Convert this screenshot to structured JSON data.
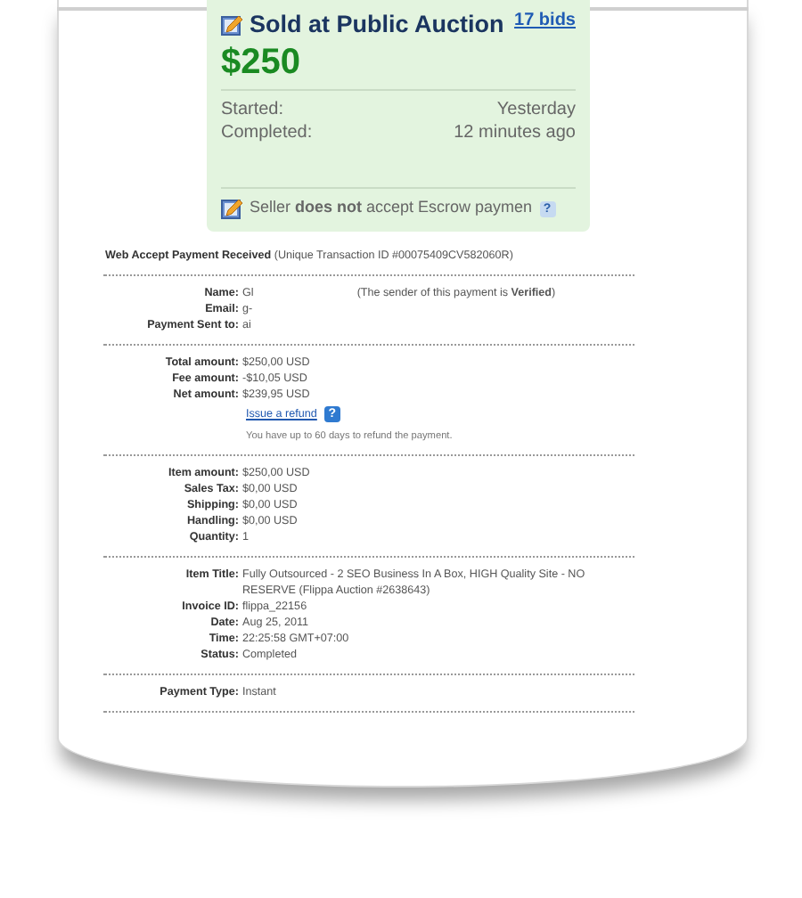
{
  "auction": {
    "title": "Sold at Public Auction",
    "bids_link": "17 bids",
    "price": "$250",
    "details": [
      {
        "label": "Started:",
        "value": "Yesterday"
      },
      {
        "label": "Completed:",
        "value": "12 minutes ago"
      }
    ],
    "escrow_note": "Seller **does not** accept Escrow paymen",
    "help": "?"
  },
  "payment": {
    "title": "Web Accept Payment Received",
    "transaction": "(Unique Transaction ID #00075409CV582060R)",
    "sections": [
      {
        "rows": [
          {
            "label": "Name:",
            "value": "Gl",
            "note": "(The sender of this payment is **Verified**)"
          },
          {
            "label": "Email:",
            "value": "g-"
          },
          {
            "label": "Payment Sent to:",
            "value": "ai"
          }
        ]
      },
      {
        "rows": [
          {
            "label": "Total amount:",
            "value": "$250,00 USD"
          },
          {
            "label": "Fee amount:",
            "value": "-$10,05 USD"
          },
          {
            "label": "Net amount:",
            "value": "$239,95 USD"
          }
        ],
        "refund": {
          "link": "Issue a refund",
          "help": "?",
          "note": "You have up to 60 days to refund the payment."
        }
      },
      {
        "rows": [
          {
            "label": "Item amount:",
            "value": "$250,00 USD"
          },
          {
            "label": "Sales Tax:",
            "value": "$0,00 USD"
          },
          {
            "label": "Shipping:",
            "value": "$0,00 USD"
          },
          {
            "label": "Handling:",
            "value": "$0,00 USD"
          },
          {
            "label": "Quantity:",
            "value": "1"
          }
        ]
      },
      {
        "rows": [
          {
            "label": "Item Title:",
            "value": "Fully Outsourced - 2 SEO Business In A Box, HIGH Quality Site - NO RESERVE (Flippa Auction #2638643)"
          },
          {
            "label": "Invoice ID:",
            "value": "flippa_22156"
          },
          {
            "label": "Date:",
            "value": "Aug 25, 2011"
          },
          {
            "label": "Time:",
            "value": "22:25:58 GMT+07:00"
          },
          {
            "label": "Status:",
            "value": "Completed"
          }
        ]
      },
      {
        "rows": [
          {
            "label": "Payment Type:",
            "value": "Instant"
          }
        ]
      }
    ]
  }
}
